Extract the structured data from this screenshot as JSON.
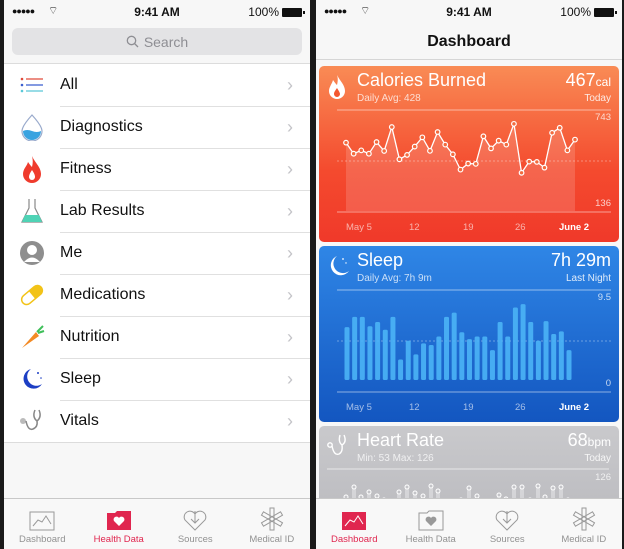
{
  "status_bar": {
    "signal": "●●●●●",
    "time": "9:41 AM",
    "battery": "100%"
  },
  "left": {
    "search_placeholder": "Search",
    "categories": [
      {
        "label": "All",
        "icon": "list-icon"
      },
      {
        "label": "Diagnostics",
        "icon": "water-drop-icon"
      },
      {
        "label": "Fitness",
        "icon": "flame-icon"
      },
      {
        "label": "Lab Results",
        "icon": "flask-icon"
      },
      {
        "label": "Me",
        "icon": "person-icon"
      },
      {
        "label": "Medications",
        "icon": "pill-icon"
      },
      {
        "label": "Nutrition",
        "icon": "carrot-icon"
      },
      {
        "label": "Sleep",
        "icon": "moon-icon"
      },
      {
        "label": "Vitals",
        "icon": "stethoscope-icon"
      }
    ],
    "active_tab": "Health Data"
  },
  "right": {
    "title": "Dashboard",
    "active_tab": "Dashboard"
  },
  "tabs": [
    {
      "label": "Dashboard",
      "icon": "dashboard-chart-icon"
    },
    {
      "label": "Health Data",
      "icon": "health-folder-icon"
    },
    {
      "label": "Sources",
      "icon": "sources-heart-icon"
    },
    {
      "label": "Medical ID",
      "icon": "medical-star-icon"
    }
  ],
  "colors": {
    "accent": "#e0264f",
    "calories": "#f4572f",
    "sleep": "#1f6fd6",
    "heart": "#c4c4c8"
  },
  "chart_data": [
    {
      "type": "line",
      "title": "Calories Burned",
      "subtitle": "Daily Avg: 428",
      "current_value": "467",
      "current_unit": "cal",
      "current_label": "Today",
      "ylim": [
        136,
        743
      ],
      "y_tick_labels": [
        "743",
        "136"
      ],
      "x_tick_labels": [
        "May 5",
        "12",
        "19",
        "26",
        "June 2"
      ],
      "values": [
        587,
        514,
        536,
        514,
        591,
        532,
        690,
        477,
        506,
        561,
        622,
        533,
        657,
        574,
        510,
        409,
        449,
        447,
        629,
        549,
        600,
        574,
        711,
        388,
        462,
        460,
        422,
        652,
        685,
        536,
        607
      ]
    },
    {
      "type": "bar",
      "title": "Sleep",
      "subtitle": "Daily Avg: 7h 9m",
      "current_value": "7h 29m",
      "current_label": "Last Night",
      "ylim": [
        0,
        9.5
      ],
      "y_tick_labels": [
        "9.5",
        "0"
      ],
      "x_tick_labels": [
        "May 5",
        "12",
        "19",
        "26",
        "June 2"
      ],
      "values": [
        6.2,
        7.4,
        7.4,
        6.3,
        6.8,
        5.9,
        7.4,
        2.4,
        4.6,
        3.0,
        4.3,
        4.1,
        5.1,
        7.4,
        7.9,
        5.6,
        4.8,
        5.1,
        5.1,
        3.5,
        6.8,
        5.1,
        8.5,
        8.9,
        6.8,
        4.6,
        6.9,
        5.4,
        5.7,
        3.5
      ]
    },
    {
      "type": "scatter",
      "title": "Heart Rate",
      "subtitle": "Min: 53 Max: 126",
      "current_value": "68",
      "current_unit": "bpm",
      "current_label": "Today",
      "y_tick_labels": [
        "126"
      ]
    }
  ]
}
